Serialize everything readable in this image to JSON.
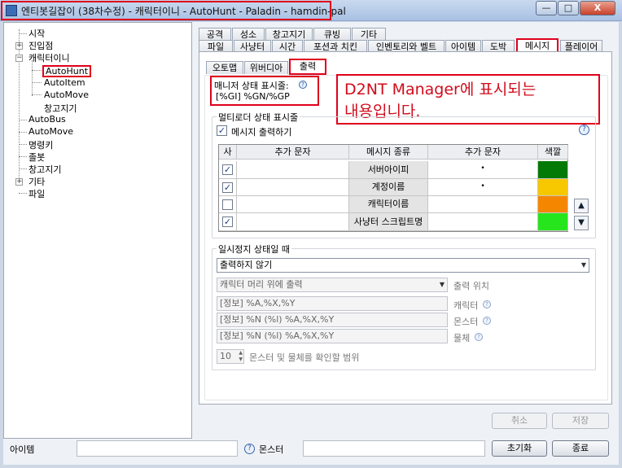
{
  "window": {
    "title": "엔티봇길잡이 (38차수정) - 캐릭터이니 - AutoHunt - Paladin - hamdin-pal",
    "minimize_label": "—",
    "maximize_label": "□",
    "close_label": "X"
  },
  "tree": {
    "items": [
      {
        "label": "시작"
      },
      {
        "label": "진입점"
      },
      {
        "label": "캐릭터이니"
      },
      {
        "label": "AutoHunt"
      },
      {
        "label": "AutoItem"
      },
      {
        "label": "AutoMove"
      },
      {
        "label": "창고지기"
      },
      {
        "label": "AutoBus"
      },
      {
        "label": "AutoMove"
      },
      {
        "label": "명령키"
      },
      {
        "label": "졸봇"
      },
      {
        "label": "창고지기"
      },
      {
        "label": "기타"
      },
      {
        "label": "파일"
      }
    ]
  },
  "tabs_row1": [
    "공격",
    "성소",
    "창고지기",
    "큐빙",
    "기타"
  ],
  "tabs_row2": [
    "파일",
    "사냥터",
    "시간",
    "포션과 치킨",
    "인벤토리와 벨트",
    "아이템",
    "도박",
    "메시지",
    "플레이어"
  ],
  "subtabs": [
    "오토맵",
    "위버디아",
    "출력"
  ],
  "manager_status": {
    "label": "매니저 상태 표시줄:",
    "value": "[%GI] %GN/%GP"
  },
  "annotation": {
    "line1": "D2NT Manager에 표시되는",
    "line2": "내용입니다."
  },
  "multiloader": {
    "label": "멀티로더 상태 표시줄",
    "checkbox_label": "메시지 출력하기",
    "checked": true,
    "grid": {
      "headers": [
        "사",
        "추가 문자",
        "메시지 종류",
        "추가 문자",
        "색깔"
      ],
      "rows": [
        {
          "checked": true,
          "pre": "",
          "type": "서버아이피",
          "post": "•",
          "color": "#037a06"
        },
        {
          "checked": true,
          "pre": "",
          "type": "계정이름",
          "post": "•",
          "color": "#f7c800"
        },
        {
          "checked": false,
          "pre": "",
          "type": "캐릭터이름",
          "post": "",
          "color": "#f58700"
        },
        {
          "checked": true,
          "pre": "",
          "type": "사냥터 스크립트명",
          "post": "",
          "color": "#27e51c"
        }
      ]
    },
    "up_label": "▲",
    "down_label": "▼"
  },
  "pause": {
    "label": "일시정지 상태일 때",
    "mode_value": "출력하지 않기",
    "position_value": "캐릭터 머리 위에 출력",
    "position_label": "출력 위치",
    "character_format": "[정보] %A,%X,%Y",
    "character_label": "캐릭터",
    "monster_format": "[정보] %N (%l) %A,%X,%Y",
    "monster_label": "몬스터",
    "object_format": "[정보] %N (%l) %A,%X,%Y",
    "object_label": "물체",
    "range_value": "10",
    "range_label": "몬스터 및 물체를 확인할 범위"
  },
  "buttons": {
    "cancel": "취소",
    "save": "저장",
    "reset": "초기화",
    "exit": "종료"
  },
  "status": {
    "left_label": "아이템",
    "mid_label": "몬스터"
  },
  "colors": {
    "highlight": "#e0001b",
    "annotation_text": "#d20b1b"
  }
}
